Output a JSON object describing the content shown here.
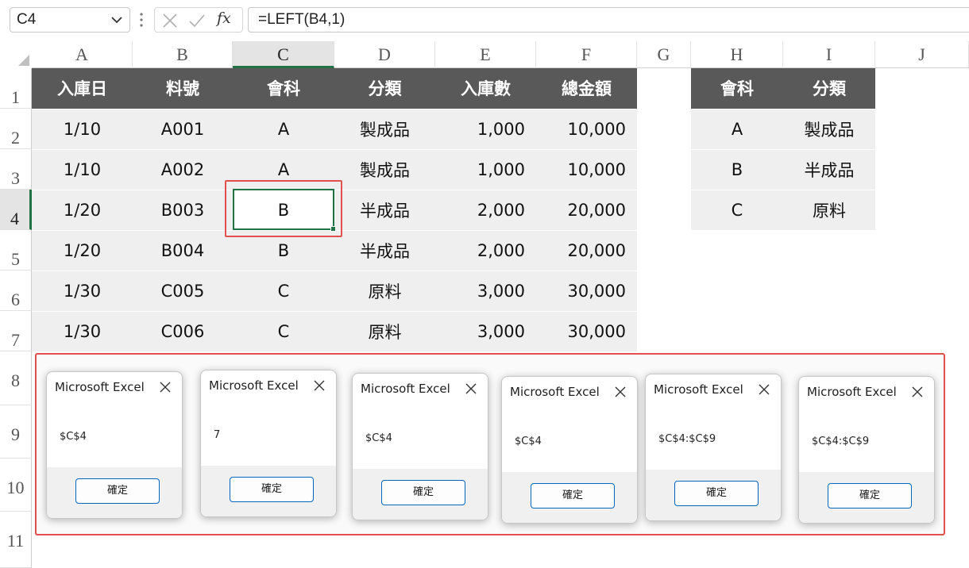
{
  "name_box": {
    "value": "C4"
  },
  "formula": {
    "text": "=LEFT(B4,1)",
    "fx_label": "fx"
  },
  "columns": [
    "A",
    "B",
    "C",
    "D",
    "E",
    "F",
    "G",
    "H",
    "I",
    "J"
  ],
  "rows": [
    "1",
    "2",
    "3",
    "4",
    "5",
    "6",
    "7",
    "8",
    "9",
    "10",
    "11"
  ],
  "selected": {
    "column": "C",
    "row": "4"
  },
  "main_table": {
    "headers": [
      "入庫日",
      "料號",
      "會科",
      "分類",
      "入庫數",
      "總金額"
    ],
    "rows": [
      [
        "1/10",
        "A001",
        "A",
        "製成品",
        "1,000",
        "10,000"
      ],
      [
        "1/10",
        "A002",
        "A",
        "製成品",
        "1,000",
        "10,000"
      ],
      [
        "1/20",
        "B003",
        "B",
        "半成品",
        "2,000",
        "20,000"
      ],
      [
        "1/20",
        "B004",
        "B",
        "半成品",
        "2,000",
        "20,000"
      ],
      [
        "1/30",
        "C005",
        "C",
        "原料",
        "3,000",
        "30,000"
      ],
      [
        "1/30",
        "C006",
        "C",
        "原料",
        "3,000",
        "30,000"
      ]
    ]
  },
  "lookup_table": {
    "headers": [
      "會科",
      "分類"
    ],
    "rows": [
      [
        "A",
        "製成品"
      ],
      [
        "B",
        "半成品"
      ],
      [
        "C",
        "原料"
      ]
    ]
  },
  "dialogs": [
    {
      "title": "Microsoft Excel",
      "message": "$C$4",
      "button": "確定"
    },
    {
      "title": "Microsoft Excel",
      "message": "7",
      "button": "確定"
    },
    {
      "title": "Microsoft Excel",
      "message": "$C$4",
      "button": "確定"
    },
    {
      "title": "Microsoft Excel",
      "message": "$C$4",
      "button": "確定"
    },
    {
      "title": "Microsoft Excel",
      "message": "$C$4:$C$9",
      "button": "確定"
    },
    {
      "title": "Microsoft Excel",
      "message": "$C$4:$C$9",
      "button": "確定"
    }
  ],
  "colors": {
    "header_fill": "#595959",
    "body_fill": "#efefef",
    "selection": "#217346",
    "highlight": "#e0504e",
    "dialog_button_border": "#0067c0"
  }
}
